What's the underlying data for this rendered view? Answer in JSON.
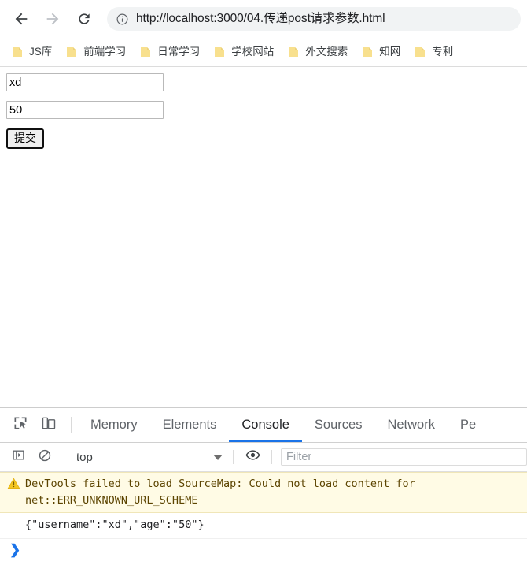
{
  "browser": {
    "nav": {
      "back_icon": "arrow-left-icon",
      "forward_icon": "arrow-right-icon",
      "reload_icon": "reload-icon"
    },
    "omnibox": {
      "security_icon": "info-circle-icon",
      "url": "http://localhost:3000/04.传递post请求参数.html"
    },
    "bookmarks": [
      {
        "label": "JS库",
        "icon": "folder-icon"
      },
      {
        "label": "前端学习",
        "icon": "folder-icon"
      },
      {
        "label": "日常学习",
        "icon": "folder-icon"
      },
      {
        "label": "学校网站",
        "icon": "folder-icon"
      },
      {
        "label": "外文搜索",
        "icon": "folder-icon"
      },
      {
        "label": "知网",
        "icon": "folder-icon"
      },
      {
        "label": "专利",
        "icon": "folder-icon"
      }
    ]
  },
  "page": {
    "username_value": "xd",
    "username_placeholder": "",
    "age_value": "50",
    "age_placeholder": "",
    "submit_label": "提交"
  },
  "devtools": {
    "toolbar_icons": {
      "inspect": "inspect-element-icon",
      "device": "device-toolbar-icon"
    },
    "tabs": [
      {
        "label": "Memory",
        "active": false
      },
      {
        "label": "Elements",
        "active": false
      },
      {
        "label": "Console",
        "active": true
      },
      {
        "label": "Sources",
        "active": false
      },
      {
        "label": "Network",
        "active": false
      },
      {
        "label": "Pe",
        "active": false
      }
    ],
    "active_tab": "Console",
    "accent_color": "#1a73e8",
    "console_toolbar": {
      "sidebar_icon": "console-sidebar-icon",
      "clear_icon": "clear-console-icon",
      "context": "top",
      "eye_icon": "live-expression-eye-icon",
      "filter_placeholder": "Filter",
      "filter_value": ""
    },
    "console_messages": [
      {
        "type": "warning",
        "icon": "warning-triangle-icon",
        "line1": "DevTools failed to load SourceMap: Could not load content for",
        "line2": "net::ERR_UNKNOWN_URL_SCHEME"
      },
      {
        "type": "log",
        "text": "{\"username\":\"xd\",\"age\":\"50\"}"
      }
    ],
    "prompt_symbol": "❯"
  }
}
